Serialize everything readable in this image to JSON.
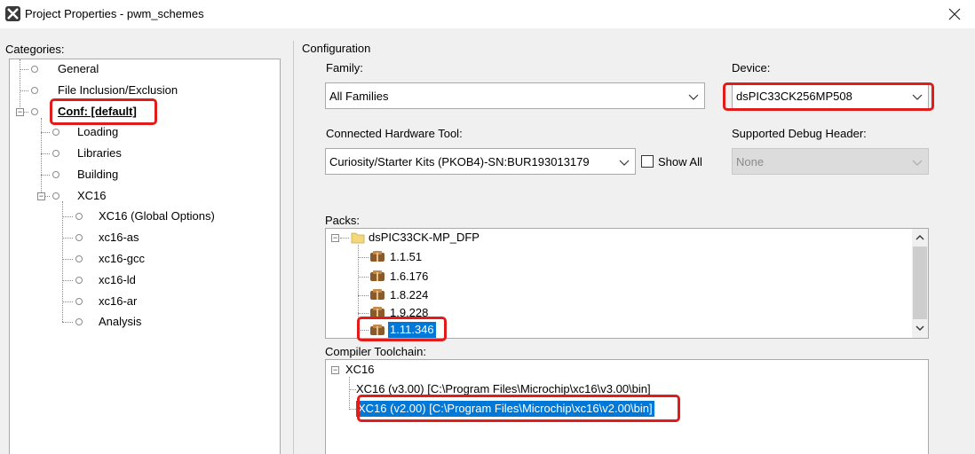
{
  "window": {
    "title": "Project Properties - pwm_schemes"
  },
  "categories": {
    "label": "Categories:",
    "items": [
      {
        "label": "General"
      },
      {
        "label": "File Inclusion/Exclusion"
      },
      {
        "label": "Conf: [default]"
      },
      {
        "label": "Loading"
      },
      {
        "label": "Libraries"
      },
      {
        "label": "Building"
      },
      {
        "label": "XC16"
      },
      {
        "label": "XC16 (Global Options)"
      },
      {
        "label": "xc16-as"
      },
      {
        "label": "xc16-gcc"
      },
      {
        "label": "xc16-ld"
      },
      {
        "label": "xc16-ar"
      },
      {
        "label": "Analysis"
      }
    ]
  },
  "configuration": {
    "group_label": "Configuration",
    "family": {
      "label": "Family:",
      "value": "All Families"
    },
    "device": {
      "label": "Device:",
      "value": "dsPIC33CK256MP508"
    },
    "hardware_tool": {
      "label": "Connected Hardware Tool:",
      "value": "Curiosity/Starter Kits (PKOB4)-SN:BUR193013179",
      "show_all_label": "Show All"
    },
    "debug_header": {
      "label": "Supported Debug Header:",
      "value": "None"
    },
    "packs": {
      "label": "Packs:",
      "root": "dsPIC33CK-MP_DFP",
      "versions": [
        "1.1.51",
        "1.6.176",
        "1.8.224",
        "1.9.228",
        "1.11.346"
      ],
      "selected": "1.11.346"
    },
    "toolchain": {
      "label": "Compiler Toolchain:",
      "root": "XC16",
      "items": [
        "XC16 (v3.00) [C:\\Program Files\\Microchip\\xc16\\v3.00\\bin]",
        "XC16 (v2.00) [C:\\Program Files\\Microchip\\xc16\\v2.00\\bin]"
      ],
      "selected": "XC16 (v2.00) [C:\\Program Files\\Microchip\\xc16\\v2.00\\bin]"
    }
  },
  "colors": {
    "selection": "#0078d7",
    "highlight_box": "#e21b1b",
    "window_bg": "#f0f0f0"
  },
  "icons": [
    "app-icon",
    "close-icon",
    "chevron-down-icon",
    "tree-bullet-icon",
    "folder-icon",
    "package-icon",
    "scroll-up-icon",
    "scroll-down-icon"
  ]
}
